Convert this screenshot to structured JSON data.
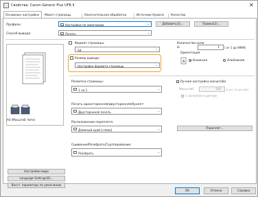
{
  "window": {
    "title": "Свойства: Canon Generic Plus UFR II",
    "close_glyph": "✕"
  },
  "tabs": [
    {
      "label": "Основные настройки"
    },
    {
      "label": "Макет страницы"
    },
    {
      "label": "Окончательная обработка"
    },
    {
      "label": "Источник бумаги"
    },
    {
      "label": "Качество"
    }
  ],
  "profile": {
    "label": "Профиль:",
    "value": "Настройки по умолчанию",
    "add_button": "Добавить(1)...",
    "edit_button": "Правка(2)..."
  },
  "output_method": {
    "label": "Способ вывода:",
    "value": "Печать"
  },
  "preview": {
    "caption": "A4 (Масштаб: Авто)"
  },
  "page_size": {
    "label": "Формат страницы:",
    "value": "A4"
  },
  "output_size": {
    "label": "Размер вывода:",
    "value": "Настройка формата страницы"
  },
  "copies": {
    "label": "Количество копи",
    "label2": "й:",
    "value": "1",
    "range": "[ от 1 до 9999]"
  },
  "orientation": {
    "label": "Ориентация",
    "portrait": "Книжная",
    "landscape": "Альбомная",
    "selected": "portrait"
  },
  "page_layout": {
    "label": "Разметка страницы:",
    "value": "1 на 1"
  },
  "manual_scaling": {
    "label": "Ручная настройка масштаба",
    "scale_label": "Масштаб:",
    "scale_value": "100",
    "scale_range": "% [от 25 до 200]",
    "center_label": "С началом в центре"
  },
  "duplex": {
    "label": "Печать односторонняя/двусторонняя/буклет:",
    "value": "Двусторонняя печать"
  },
  "binding": {
    "label": "Расположение переплета:",
    "value": "Длинный край [слева]",
    "button": "Переплет..."
  },
  "staple": {
    "label": "Сшивание/Разобрать/Группирование:",
    "value": "Разобрать"
  },
  "left_buttons": {
    "view_settings": "Настройки вида",
    "language": "Language Settings(K)...",
    "restore": "Восст. параметры по умолчанию"
  },
  "footer": {
    "ok": "OK",
    "cancel": "Отмена",
    "help": "Справка"
  }
}
